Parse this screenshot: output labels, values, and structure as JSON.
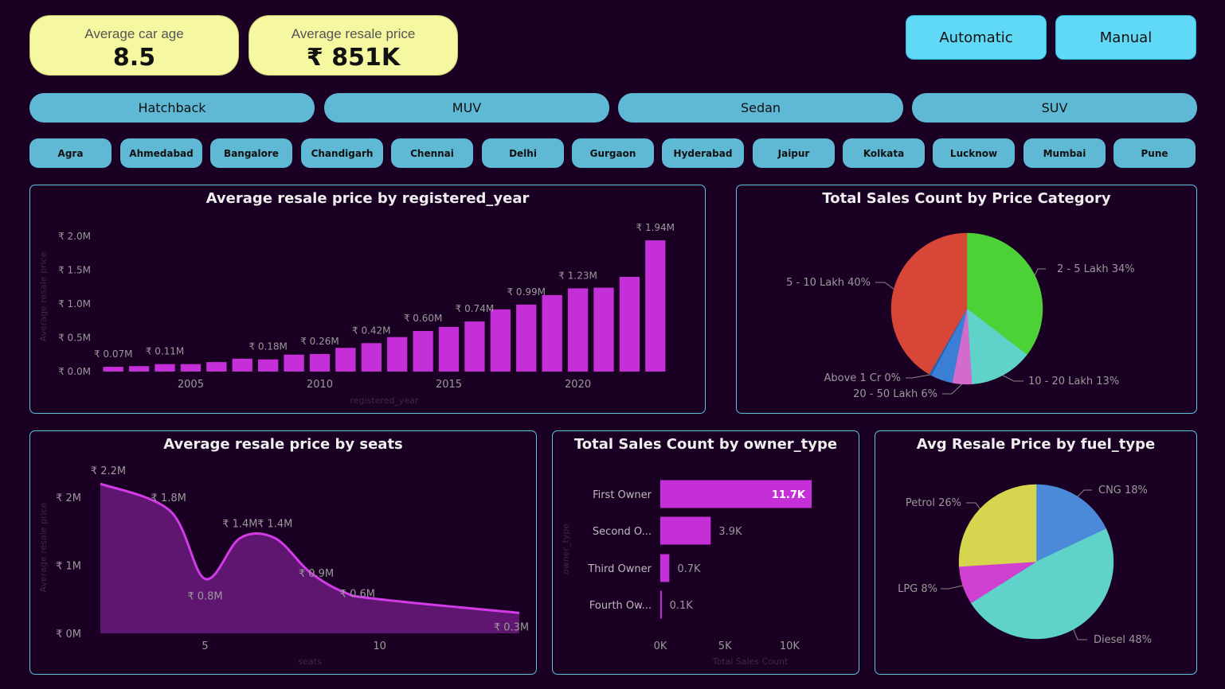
{
  "kpis": {
    "avg_car_age": {
      "label": "Average car age",
      "value": "8.5"
    },
    "avg_resale_price": {
      "label": "Average resale price",
      "value": "₹ 851K"
    }
  },
  "transmission_buttons": [
    "Automatic",
    "Manual"
  ],
  "category_buttons": [
    "Hatchback",
    "MUV",
    "Sedan",
    "SUV"
  ],
  "city_buttons": [
    "Agra",
    "Ahmedabad",
    "Bangalore",
    "Chandigarh",
    "Chennai",
    "Delhi",
    "Gurgaon",
    "Hyderabad",
    "Jaipur",
    "Kolkata",
    "Lucknow",
    "Mumbai",
    "Pune"
  ],
  "colors": {
    "bar": "#c42fd8",
    "area_fill": "#5e1670",
    "area_line": "#d23be6",
    "panel_border": "#5fc4e0",
    "background": "#1a0022"
  },
  "chart_data": [
    {
      "type": "bar",
      "title": "Average resale price by registered_year",
      "xlabel": "registered_year",
      "ylabel": "Average resale price",
      "x_ticks": [
        "2005",
        "2010",
        "2015",
        "2020"
      ],
      "y_ticks": [
        "₹ 0.0M",
        "₹ 0.5M",
        "₹ 1.0M",
        "₹ 1.5M",
        "₹ 2.0M"
      ],
      "ylim": [
        0,
        2.0
      ],
      "categories": [
        2002,
        2003,
        2004,
        2005,
        2006,
        2007,
        2008,
        2009,
        2010,
        2011,
        2012,
        2013,
        2014,
        2015,
        2016,
        2017,
        2018,
        2019,
        2020,
        2021,
        2022,
        2023
      ],
      "values": [
        0.07,
        0.08,
        0.11,
        0.11,
        0.14,
        0.19,
        0.18,
        0.25,
        0.26,
        0.35,
        0.42,
        0.51,
        0.6,
        0.66,
        0.74,
        0.92,
        0.99,
        1.13,
        1.23,
        1.24,
        1.4,
        1.94
      ],
      "data_labels": [
        {
          "index": 0,
          "text": "₹ 0.07M"
        },
        {
          "index": 2,
          "text": "₹ 0.11M"
        },
        {
          "index": 6,
          "text": "₹ 0.18M"
        },
        {
          "index": 8,
          "text": "₹ 0.26M"
        },
        {
          "index": 10,
          "text": "₹ 0.42M"
        },
        {
          "index": 12,
          "text": "₹ 0.60M"
        },
        {
          "index": 14,
          "text": "₹ 0.74M"
        },
        {
          "index": 16,
          "text": "₹ 0.99M"
        },
        {
          "index": 18,
          "text": "₹ 1.23M"
        },
        {
          "index": 21,
          "text": "₹ 1.94M"
        }
      ]
    },
    {
      "type": "pie",
      "title": "Total Sales Count by Price Category",
      "slices": [
        {
          "label": "2 - 5 Lakh 34%",
          "value": 34,
          "color": "#4cd137"
        },
        {
          "label": "10 - 20 Lakh 13%",
          "value": 13,
          "color": "#5fd3c9"
        },
        {
          "label": "20 - 50 Lakh 6%",
          "value": 4,
          "color": "#d36bcc"
        },
        {
          "label": "",
          "value": 4.5,
          "color": "#3a7fd5"
        },
        {
          "label": "Above 1 Cr 0%",
          "value": 0.5,
          "color": "#2a5fb0"
        },
        {
          "label": "5 - 10 Lakh 40%",
          "value": 40,
          "color": "#d84638"
        }
      ]
    },
    {
      "type": "area",
      "title": "Average resale price by seats",
      "xlabel": "seats",
      "ylabel": "Average resale price",
      "x_ticks": [
        "5",
        "10"
      ],
      "y_ticks": [
        "₹ 0M",
        "₹ 1M",
        "₹ 2M"
      ],
      "xlim": [
        2,
        14
      ],
      "ylim": [
        0,
        2.2
      ],
      "x": [
        2,
        4,
        5,
        6,
        7,
        8,
        9,
        10,
        14
      ],
      "y": [
        2.2,
        1.8,
        0.8,
        1.4,
        1.4,
        0.9,
        0.6,
        0.5,
        0.3
      ],
      "data_labels": [
        "₹ 2.2M",
        "₹ 1.8M",
        "₹ 0.8M",
        "₹ 1.4M",
        "₹ 1.4M",
        "₹ 0.9M",
        "₹ 0.6M",
        "",
        "₹ 0.3M"
      ]
    },
    {
      "type": "bar",
      "orientation": "horizontal",
      "title": "Total Sales Count by owner_type",
      "xlabel": "Total Sales Count",
      "ylabel": "owner_type",
      "x_ticks": [
        "0K",
        "5K",
        "10K"
      ],
      "xlim": [
        0,
        11.7
      ],
      "categories": [
        "First Owner",
        "Second O...",
        "Third Owner",
        "Fourth Ow..."
      ],
      "values": [
        11.7,
        3.9,
        0.7,
        0.1
      ],
      "data_labels": [
        "11.7K",
        "3.9K",
        "0.7K",
        "0.1K"
      ]
    },
    {
      "type": "pie",
      "title": "Avg Resale Price by fuel_type",
      "slices": [
        {
          "label": "CNG 18%",
          "value": 18,
          "color": "#4a8ad8"
        },
        {
          "label": "Diesel 48%",
          "value": 48,
          "color": "#5fd3c9"
        },
        {
          "label": "LPG 8%",
          "value": 8,
          "color": "#cf3fd0"
        },
        {
          "label": "Petrol 26%",
          "value": 26,
          "color": "#d5d550"
        }
      ]
    }
  ]
}
